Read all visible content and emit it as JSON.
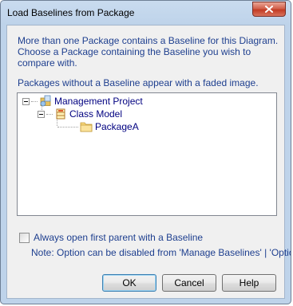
{
  "window": {
    "title": "Load Baselines from Package"
  },
  "message": {
    "line1": "More than one Package contains a Baseline for this Diagram.",
    "line2": "Choose a Package containing the Baseline you wish to",
    "line3": "compare with.",
    "faded_note": "Packages without a Baseline appear with a faded image."
  },
  "tree": {
    "nodes": [
      {
        "label": "Management Project",
        "icon": "project-icon",
        "level": 0,
        "expanded": true
      },
      {
        "label": "Class Model",
        "icon": "class-model-icon",
        "level": 1,
        "expanded": true
      },
      {
        "label": "PackageA",
        "icon": "package-folder-icon",
        "level": 2,
        "selected": true
      }
    ]
  },
  "option": {
    "label": "Always open first parent with a Baseline",
    "checked": false,
    "note": "Note: Option can be disabled from 'Manage Baselines' | 'Options'"
  },
  "buttons": {
    "ok": "OK",
    "cancel": "Cancel",
    "help": "Help"
  },
  "colors": {
    "frame": "#bed3ea",
    "client": "#f0f0f0",
    "text_blue": "#1e3f8f",
    "tree_text": "#000080",
    "close_red": "#c23b23"
  }
}
